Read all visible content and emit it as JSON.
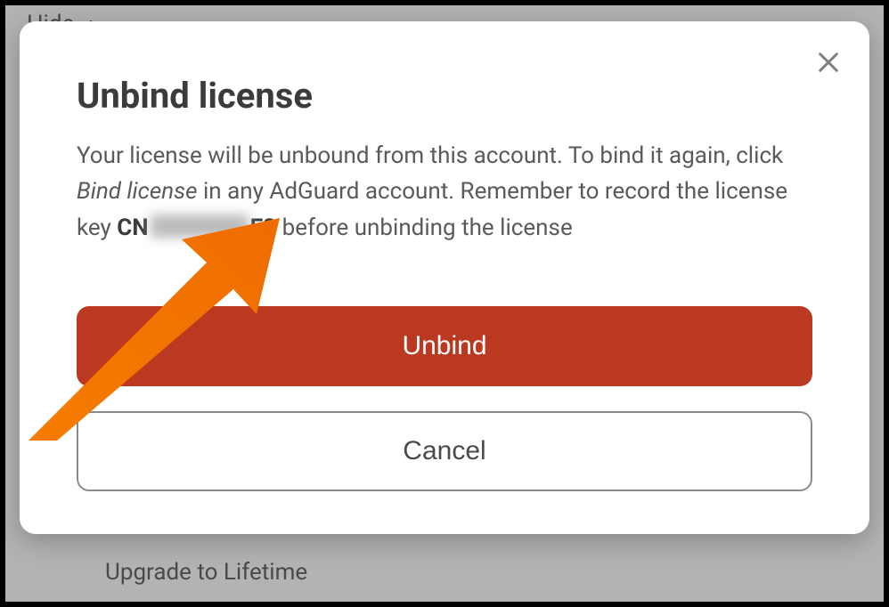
{
  "background": {
    "hide_label": "Hide",
    "upgrade_label": "Upgrade to Lifetime"
  },
  "modal": {
    "title": "Unbind license",
    "body_part1": "Your license will be unbound from this account. To bind it again, click ",
    "body_italic": "Bind license",
    "body_part2": " in any AdGuard account. Remember to record the license key ",
    "key_prefix": "CN",
    "key_suffix": "E3",
    "body_part3": " before unbinding the license",
    "unbind_label": "Unbind",
    "cancel_label": "Cancel"
  },
  "colors": {
    "primary": "#bb3821",
    "annotation": "#f57c00"
  }
}
